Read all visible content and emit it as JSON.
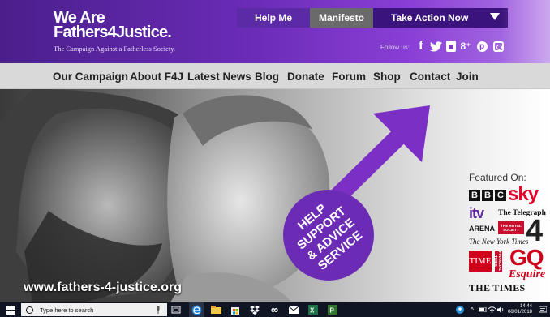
{
  "header": {
    "logo_line1": "We Are",
    "logo_line2": "Fathers4Justice.",
    "tagline": "The Campaign Against a Fatherless Society.",
    "top_nav": [
      {
        "label": "Help Me"
      },
      {
        "label": "Manifesto"
      },
      {
        "label": "Take Action Now"
      }
    ],
    "follow_label": "Follow us:",
    "social": {
      "facebook": "f",
      "twitter": "🐦",
      "googleplus": "8⁺",
      "pinterest": "p"
    }
  },
  "main_nav": [
    {
      "label": "Our Campaign"
    },
    {
      "label": "About F4J"
    },
    {
      "label": "Latest News"
    },
    {
      "label": "Blog"
    },
    {
      "label": "Donate"
    },
    {
      "label": "Forum"
    },
    {
      "label": "Shop"
    },
    {
      "label": "Contact"
    },
    {
      "label": "Join"
    }
  ],
  "hero": {
    "badge_lines": [
      "HELP",
      "SUPPORT",
      "& ADVICE",
      "SERVICE"
    ],
    "url": "www.fathers-4-justice.org",
    "featured_label": "Featured On:",
    "media_logos": {
      "bbc": [
        "B",
        "B",
        "C"
      ],
      "sky": "sky",
      "itv": "itv",
      "telegraph": "The Telegraph",
      "arena": "ARENA",
      "royal_society": "THE ROYAL SOCIETY",
      "nyt": "The New York Times",
      "channel4": "4",
      "time": "TIME",
      "financial_times": "FINANCIAL TIMES",
      "gq": "GQ",
      "esquire": "Esquire",
      "times": "THE TIMES"
    },
    "accent_color": "#6b2bb5"
  },
  "taskbar": {
    "search_placeholder": "Type here to search",
    "time": "14:44",
    "date": "06/01/2018"
  }
}
